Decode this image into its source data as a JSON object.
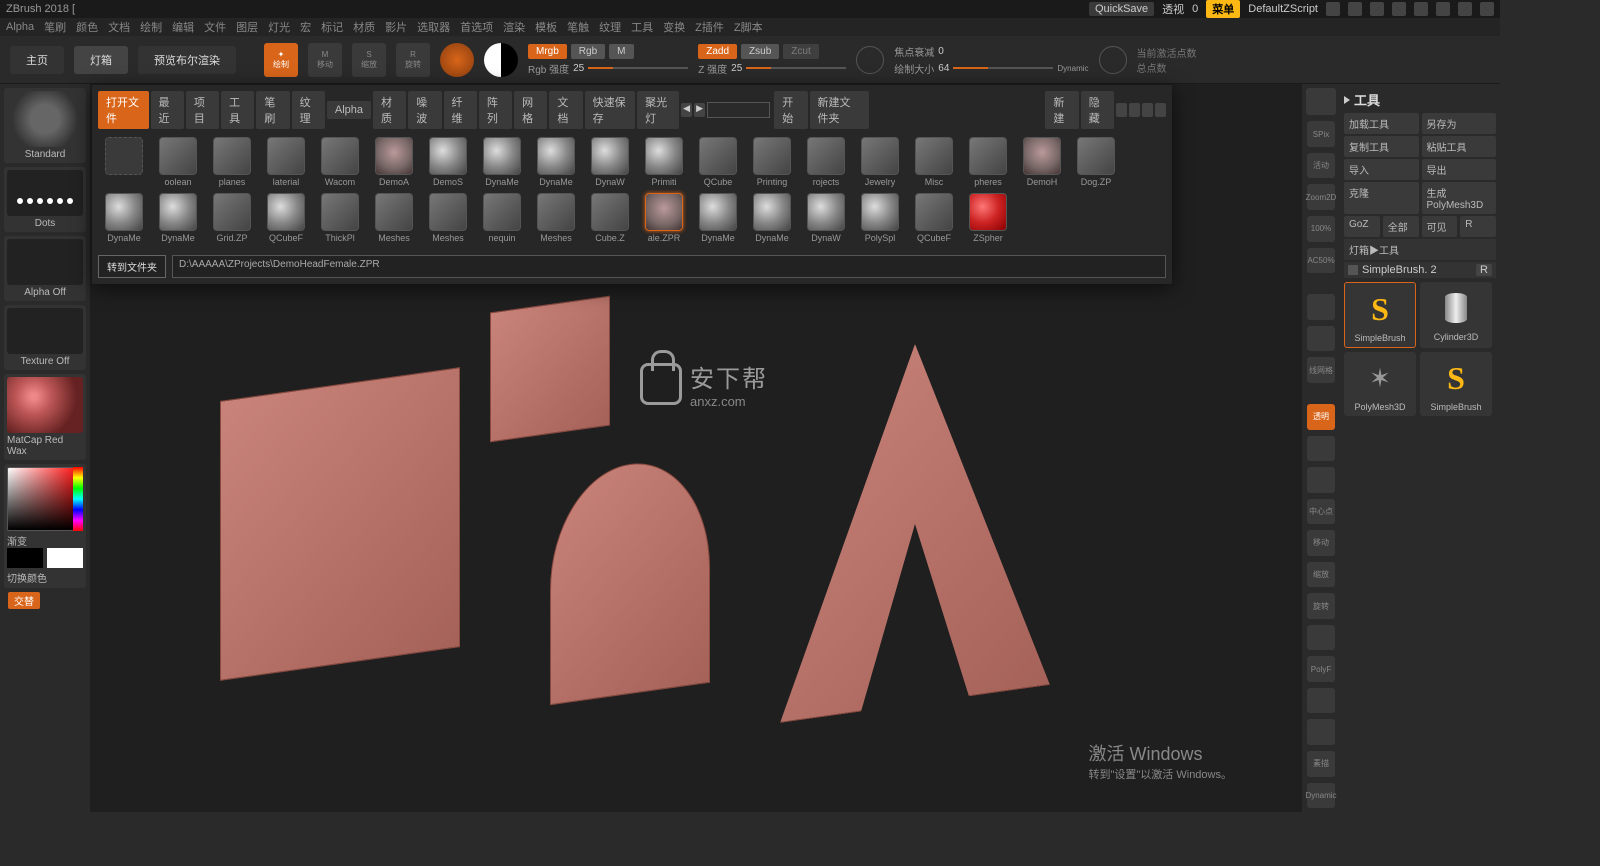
{
  "titlebar": {
    "title": "ZBrush 2018 [",
    "quicksave": "QuickSave",
    "perspective": "透视",
    "persp_val": "0",
    "menu_btn": "菜单",
    "script": "DefaultZScript"
  },
  "menubar": [
    "Alpha",
    "笔刷",
    "颜色",
    "文档",
    "绘制",
    "编辑",
    "文件",
    "图层",
    "灯光",
    "宏",
    "标记",
    "材质",
    "影片",
    "选取器",
    "首选项",
    "渲染",
    "模板",
    "笔触",
    "纹理",
    "工具",
    "变换",
    "Z插件",
    "Z脚本"
  ],
  "topshelf": {
    "tabs": [
      "主页",
      "灯箱",
      "预览布尔渲染"
    ],
    "icons": [
      "绘制",
      "移动",
      "缩放",
      "旋转"
    ],
    "mrgb": "Mrgb",
    "rgb": "Rgb",
    "m": "M",
    "rgb_intensity_label": "Rgb 强度",
    "rgb_intensity": "25",
    "zadd": "Zadd",
    "zsub": "Zsub",
    "zcut": "Zcut",
    "z_intensity_label": "Z 强度",
    "z_intensity": "25",
    "focal_label": "焦点衰减",
    "focal": "0",
    "size_label": "绘制大小",
    "size": "64",
    "dynamic": "Dynamic",
    "active_points": "当前激活点数",
    "total_points": "总点数"
  },
  "leftbar": {
    "brush": "Standard",
    "stroke": "Dots",
    "alpha": "Alpha Off",
    "texture": "Texture Off",
    "material": "MatCap Red Wax",
    "gradient": "渐变",
    "switch_color": "切换颜色",
    "swap": "交替"
  },
  "browser": {
    "tabs": [
      "打开文件",
      "最近",
      "项目",
      "工具",
      "笔刷",
      "纹理",
      "Alpha",
      "材质",
      "噪波",
      "纤维",
      "阵列",
      "网格",
      "文档",
      "快速保存",
      "聚光灯"
    ],
    "btn_start": "开始",
    "btn_newfolder": "新建文件夹",
    "btn_new": "新建",
    "btn_hide": "隐藏",
    "items": [
      {
        "name": "",
        "type": "folder"
      },
      {
        "name": "oolean"
      },
      {
        "name": "planes"
      },
      {
        "name": "laterial"
      },
      {
        "name": "Wacom"
      },
      {
        "name": "DemoA",
        "type": "head"
      },
      {
        "name": "DemoS",
        "type": "sphere"
      },
      {
        "name": "DynaMe",
        "type": "sphere"
      },
      {
        "name": "DynaMe",
        "type": "sphere"
      },
      {
        "name": "DynaW",
        "type": "sphere"
      },
      {
        "name": "Primiti",
        "type": "sphere"
      },
      {
        "name": "QCube"
      },
      {
        "name": "Printing"
      },
      {
        "name": "rojects"
      },
      {
        "name": "Jewelry"
      },
      {
        "name": "Misc"
      },
      {
        "name": "pheres"
      },
      {
        "name": "DemoH",
        "type": "head"
      },
      {
        "name": "Dog.ZP"
      },
      {
        "name": "DynaMe",
        "type": "sphere"
      },
      {
        "name": "DynaMe",
        "type": "sphere"
      },
      {
        "name": "Grid.ZP"
      },
      {
        "name": "QCubeF",
        "type": "sphere"
      },
      {
        "name": "ThickPl"
      },
      {
        "name": "Meshes"
      },
      {
        "name": "Meshes"
      },
      {
        "name": "nequin"
      },
      {
        "name": "Meshes"
      },
      {
        "name": "Cube.Z"
      },
      {
        "name": "ale.ZPR",
        "type": "head",
        "selected": true
      },
      {
        "name": "DynaMe",
        "type": "sphere"
      },
      {
        "name": "DynaMe",
        "type": "sphere"
      },
      {
        "name": "DynaW",
        "type": "sphere"
      },
      {
        "name": "PolySpl",
        "type": "sphere"
      },
      {
        "name": "QCubeF"
      },
      {
        "name": "ZSpher",
        "type": "red"
      }
    ],
    "goto": "转到文件夹",
    "path": "D:\\AAAAA\\ZProjects\\DemoHeadFemale.ZPR"
  },
  "rightnarrow_top": [
    "SPix",
    "活动",
    "Zoom2D",
    "100%",
    "AC50%"
  ],
  "rightnarrow_mid": [
    "",
    "",
    "线网格"
  ],
  "rightnarrow_tools": [
    "透明",
    "",
    "",
    "中心点",
    "移动",
    "缩放",
    "旋转",
    "",
    "PolyF",
    "",
    "",
    "素描",
    "Dynamic"
  ],
  "rightpanel": {
    "title": "工具",
    "rows": [
      [
        "加载工具",
        "另存为"
      ],
      [
        "复制工具",
        "粘贴工具"
      ],
      [
        "导入",
        "导出"
      ],
      [
        "克隆",
        "生成 PolyMesh3D"
      ],
      [
        "GoZ",
        "全部",
        "可见",
        "R"
      ]
    ],
    "crumb": "灯箱▶工具",
    "active_tool": "SimpleBrush. 2",
    "r_label": "R",
    "tools": [
      {
        "name": "SimpleBrush",
        "icon": "s",
        "selected": true
      },
      {
        "name": "Cylinder3D",
        "icon": "cyl"
      },
      {
        "name": "PolyMesh3D",
        "icon": "star"
      },
      {
        "name": "SimpleBrush",
        "icon": "s2"
      }
    ]
  },
  "watermark": {
    "big": "安下帮",
    "small": "anxz.com"
  },
  "activate": {
    "t1": "激活 Windows",
    "t2": "转到\"设置\"以激活 Windows。"
  }
}
